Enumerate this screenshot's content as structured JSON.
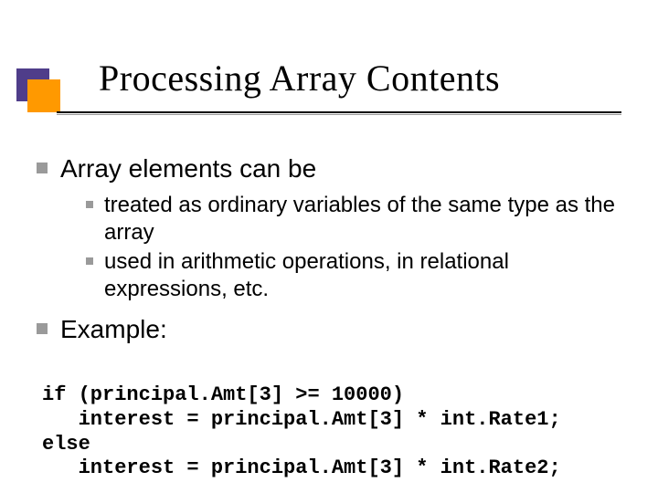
{
  "title": "Processing Array Contents",
  "bullets": {
    "item0": {
      "text": "Array elements can be",
      "sub": {
        "s0": "treated as ordinary variables of the same type as the array",
        "s1": "used in arithmetic operations, in relational expressions, etc."
      }
    },
    "item1": {
      "text": "Example:"
    }
  },
  "code": "if (principal.Amt[3] >= 10000)\n   interest = principal.Amt[3] * int.Rate1;\nelse\n   interest = principal.Amt[3] * int.Rate2;"
}
